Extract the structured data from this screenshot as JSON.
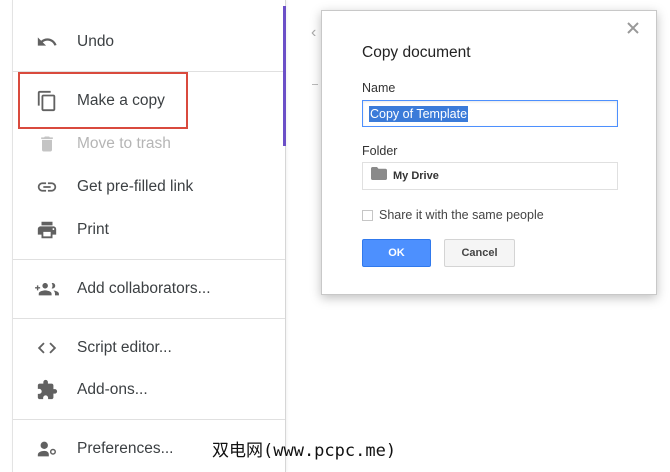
{
  "menu": {
    "items": [
      {
        "label": "Undo",
        "icon": "undo-icon"
      },
      {
        "label": "Make a copy",
        "icon": "copy-icon"
      },
      {
        "label": "Move to trash",
        "icon": "trash-icon",
        "disabled": true
      },
      {
        "label": "Get pre-filled link",
        "icon": "link-icon"
      },
      {
        "label": "Print",
        "icon": "print-icon"
      },
      {
        "label": "Add collaborators...",
        "icon": "add-collaborators-icon"
      },
      {
        "label": "Script editor...",
        "icon": "code-icon"
      },
      {
        "label": "Add-ons...",
        "icon": "puzzle-icon"
      },
      {
        "label": "Preferences...",
        "icon": "person-settings-icon"
      }
    ],
    "highlighted": "Make a copy"
  },
  "dialog": {
    "title": "Copy document",
    "name_label": "Name",
    "name_value": "Copy of Template",
    "folder_label": "Folder",
    "folder_value": "My Drive",
    "share_label": "Share it with the same people",
    "share_checked": false,
    "ok_label": "OK",
    "cancel_label": "Cancel"
  },
  "watermark": "双电网(www.pcpc.me)",
  "colors": {
    "accent": "#4d90fe",
    "highlight_box": "#d94a3d",
    "side_bar": "#6b4fc7"
  }
}
